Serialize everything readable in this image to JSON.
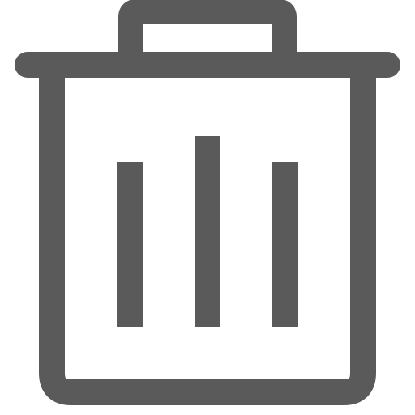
{
  "icon": {
    "name": "trash-icon",
    "color": "#5a5a5a",
    "background": "#ffffff"
  }
}
